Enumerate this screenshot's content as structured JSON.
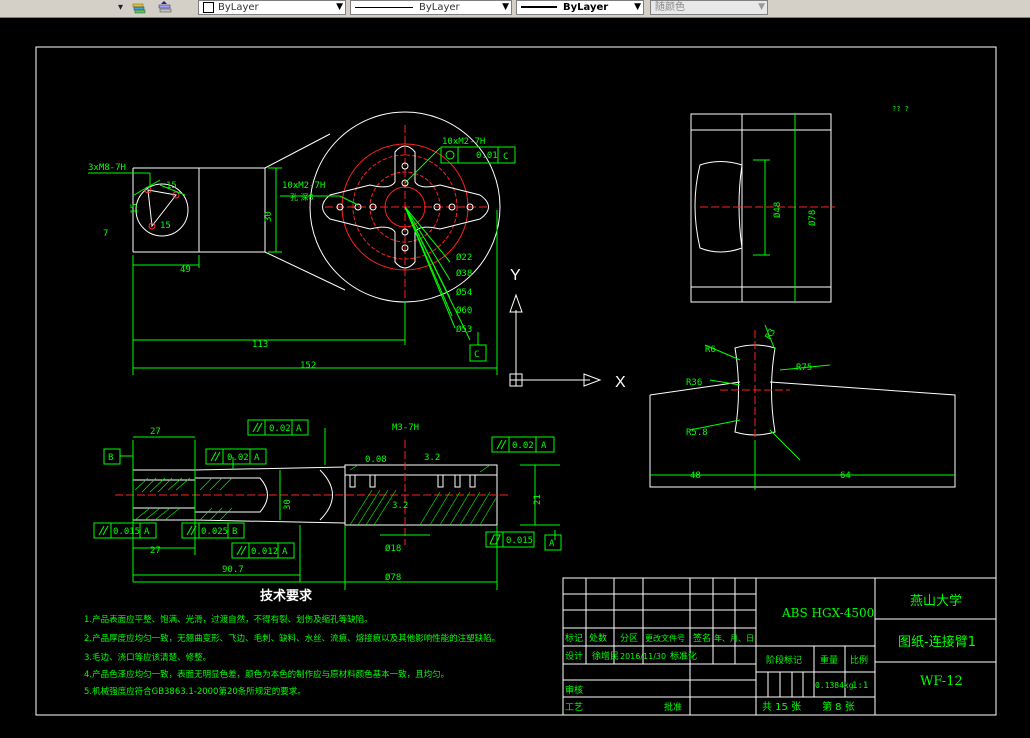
{
  "toolbar": {
    "layer_value": "ByLayer",
    "linetype_value": "ByLayer",
    "lineweight_value": "ByLayer",
    "color_value": "随颜色"
  },
  "drawing": {
    "ucs": {
      "y": "Y",
      "x": "X"
    },
    "top_view": {
      "hole_note": "3xM8-7H",
      "bolt_note": "10xM2-7H",
      "bolt_depth": "孔 深8",
      "dim_15a": "15",
      "dim_15b": "15",
      "dim_15c": "15",
      "dim_7": "7",
      "dim_30": "30",
      "dim_49": "49",
      "dim_113": "113",
      "dim_152": "152",
      "tol_flat": "0.01",
      "datum_c": "C",
      "d22": "Ø22",
      "d38": "Ø38",
      "d54": "Ø54",
      "d60": "Ø60",
      "d80": "Ø80",
      "d53": "Ø53"
    },
    "side_view": {
      "dim_a": "Ø48",
      "dim_b": "Ø78"
    },
    "corner_note": "?? ?",
    "section_view": {
      "dim_r3": "R3",
      "dim_r6": "R6",
      "dim_r36": "R36",
      "dim_r75": "R75",
      "dim_r5": "R5.8",
      "dim_48": "48",
      "dim_64": "64"
    },
    "front_view": {
      "tol_1": "0.02",
      "tol_1_datum": "A",
      "tol_2": "0.02",
      "tol_2_datum": "A",
      "tol_3": "0.02",
      "tol_3_datum": "A",
      "tol_4": "0.015",
      "tol_4_datum": "A",
      "tol_5": "0.025",
      "tol_5_datum": "B",
      "tol_6": "0.012",
      "tol_6_datum": "A",
      "tol_7": "0.015",
      "datum_b": "B",
      "datum_a": "A",
      "dim_27a": "27",
      "dim_27b": "27",
      "dim_90": "90.7",
      "dim_78": "Ø78",
      "dim_18": "Ø18",
      "dim_30": "30",
      "dim_21": "21",
      "dim_m3": "M3-7H",
      "dim_3_2": "3.2",
      "dim_0_08": "0.08",
      "dim_3_2b": "3.2"
    },
    "tech_req": {
      "title": "技术要求",
      "items": [
        "1.产品表面应平整、饱满、光滑，过渡自然，不得有裂、划伤及缩孔等缺陷。",
        "2.产品厚度应均匀一致，无翘曲变形、飞边、毛刺、缺料、水丝、流痕、熔接痕以及其他影响性能的注塑缺陷。",
        "3.毛边、浇口等应该清楚、修整。",
        "4.产品色泽应均匀一致，表面无明显色差，颜色为本色的制作应与原材料颜色基本一致，且均匀。",
        "5.机械强度应符合GB3863.1-2000第20条所规定的要求。"
      ]
    },
    "title_block": {
      "material": "ABS HGX-4500",
      "school": "燕山大学",
      "part_name": "图纸-连接臂1",
      "part_no": "WF-12",
      "hdr_mark": "标记",
      "hdr_count": "处数",
      "hdr_zone": "分区",
      "hdr_docno": "更改文件号",
      "hdr_sign": "签名",
      "hdr_date": "年、月、日",
      "designer_label": "设计",
      "designer": "徐增民",
      "date": "2016/11/30",
      "std_label": "标准化",
      "stage_label": "阶段标记",
      "weight_label": "重量",
      "scale_label": "比例",
      "weight": "0.1384kg",
      "scale": "1:1",
      "review_label": "审核",
      "process_label": "工艺",
      "approve_label": "批准",
      "total_sheets": "共 15 张",
      "sheet_no": "第 8 张"
    }
  }
}
